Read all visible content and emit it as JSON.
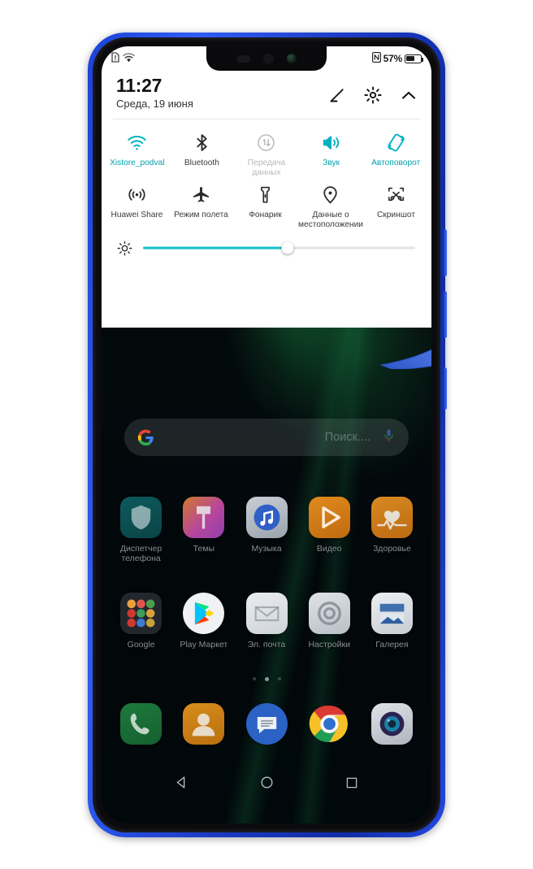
{
  "status_bar": {
    "left_icons": [
      "sim-alert-icon",
      "wifi-icon"
    ],
    "right_icons": [
      "nfc-icon"
    ],
    "battery_percent": "57%",
    "battery_level": 57
  },
  "quick_settings": {
    "clock": "11:27",
    "date": "Среда, 19 июня",
    "actions": [
      {
        "name": "edit-icon",
        "label": "Изменить"
      },
      {
        "name": "gear-icon",
        "label": "Настройки"
      },
      {
        "name": "chevron-up-icon",
        "label": "Свернуть"
      }
    ],
    "accent_color": "#00a2ae",
    "toggles": [
      {
        "label": "Xistore_podval",
        "icon": "wifi-icon",
        "state": "on"
      },
      {
        "label": "Bluetooth",
        "icon": "bluetooth-icon",
        "state": "off"
      },
      {
        "label": "Передача данных",
        "icon": "mobile-data-icon",
        "state": "disabled"
      },
      {
        "label": "Звук",
        "icon": "sound-icon",
        "state": "on"
      },
      {
        "label": "Автоповорот",
        "icon": "auto-rotate-icon",
        "state": "on"
      },
      {
        "label": "Huawei Share",
        "icon": "huawei-share-icon",
        "state": "off"
      },
      {
        "label": "Режим полета",
        "icon": "airplane-icon",
        "state": "off"
      },
      {
        "label": "Фонарик",
        "icon": "flashlight-icon",
        "state": "off"
      },
      {
        "label": "Данные о местоположении",
        "icon": "location-icon",
        "state": "off"
      },
      {
        "label": "Скриншот",
        "icon": "screenshot-icon",
        "state": "off"
      }
    ],
    "brightness": {
      "icon": "brightness-icon",
      "value": 53
    }
  },
  "search": {
    "placeholder": "Поиск....",
    "logo": "google-g-icon",
    "mic": "mic-icon"
  },
  "home": {
    "rows": [
      [
        {
          "label": "Диспетчер телефона",
          "icon": "phone-manager-icon"
        },
        {
          "label": "Темы",
          "icon": "themes-icon"
        },
        {
          "label": "Музыка",
          "icon": "music-icon"
        },
        {
          "label": "Видео",
          "icon": "video-icon"
        },
        {
          "label": "Здоровье",
          "icon": "health-icon"
        }
      ],
      [
        {
          "label": "Google",
          "icon": "google-folder-icon"
        },
        {
          "label": "Play Маркет",
          "icon": "play-store-icon"
        },
        {
          "label": "Эл. почта",
          "icon": "email-icon"
        },
        {
          "label": "Настройки",
          "icon": "settings-icon"
        },
        {
          "label": "Галерея",
          "icon": "gallery-icon"
        }
      ]
    ],
    "dock": [
      {
        "label": "",
        "icon": "phone-icon"
      },
      {
        "label": "",
        "icon": "contacts-icon"
      },
      {
        "label": "",
        "icon": "messages-icon"
      },
      {
        "label": "",
        "icon": "chrome-icon"
      },
      {
        "label": "",
        "icon": "camera-icon"
      }
    ],
    "page_dots": {
      "count": 3,
      "active_index": 1
    }
  },
  "nav_bar": [
    {
      "name": "back-button",
      "icon": "triangle-left-icon"
    },
    {
      "name": "home-button",
      "icon": "circle-icon"
    },
    {
      "name": "recents-button",
      "icon": "square-icon"
    }
  ],
  "annotation": {
    "arrow": "curved-up-arrow",
    "points_to": "Скриншот",
    "color": "#3f69d8"
  }
}
